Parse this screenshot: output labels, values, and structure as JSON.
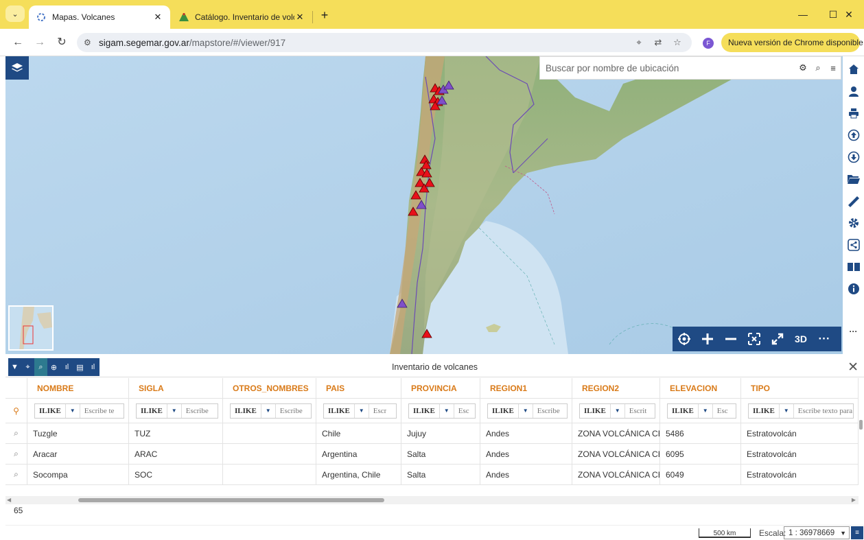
{
  "browser": {
    "tabs": [
      {
        "title": "Mapas. Volcanes",
        "active": true
      },
      {
        "title": "Catálogo. Inventario de volcane",
        "active": false
      }
    ],
    "new_tab_label": "+",
    "url_host": "sigam.segemar.gov.ar",
    "url_path": "/mapstore/#/viewer/917",
    "profile_initial": "F",
    "update_label": "Nueva versión de Chrome disponible"
  },
  "map": {
    "search_placeholder": "Buscar por nombre de ubicación",
    "tools": [
      "locate",
      "zoom-in",
      "zoom-out",
      "zoom-to-extent",
      "fullscreen",
      "3D",
      "more"
    ],
    "three_d_label": "3D",
    "more_label": "···"
  },
  "right_toolbar": [
    "home",
    "user",
    "print",
    "upload",
    "download",
    "folder",
    "measure",
    "settings",
    "share",
    "catalog",
    "info",
    "more"
  ],
  "attribute_table": {
    "title": "Inventario de volcanes",
    "columns": [
      "NOMBRE",
      "SIGLA",
      "OTROS_NOMBRES",
      "PAIS",
      "PROVINCIA",
      "REGION1",
      "REGION2",
      "ELEVACION",
      "TIPO"
    ],
    "filter_operator": "ILIKE",
    "filter_placeholders": [
      "Escribe te",
      "Escribe",
      "Escribe",
      "Escr",
      "Esc",
      "Escribe",
      "Escrit",
      "Esc",
      "Escribe texto para"
    ],
    "rows": [
      [
        "Tuzgle",
        "TUZ",
        "",
        "Chile",
        "Jujuy",
        "Andes",
        "ZONA VOLCÁNICA CE",
        "5486",
        "Estratovolcán"
      ],
      [
        "Aracar",
        "ARAC",
        "",
        "Argentina",
        "Salta",
        "Andes",
        "ZONA VOLCÁNICA CE",
        "6095",
        "Estratovolcán"
      ],
      [
        "Socompa",
        "SOC",
        "",
        "Argentina, Chile",
        "Salta",
        "Andes",
        "ZONA VOLCÁNICA CE",
        "6049",
        "Estratovolcán"
      ]
    ],
    "record_count": "65"
  },
  "footer": {
    "scalebar_label": "500 km",
    "scale_label": "Escala:",
    "scale_value": "1 : 36978669"
  },
  "colors": {
    "accent": "#1f4a84",
    "header_text": "#d97a18",
    "chrome_yellow": "#f5de5a",
    "volcano_red": "#e8101a",
    "volcano_purple": "#7f4fc9"
  }
}
